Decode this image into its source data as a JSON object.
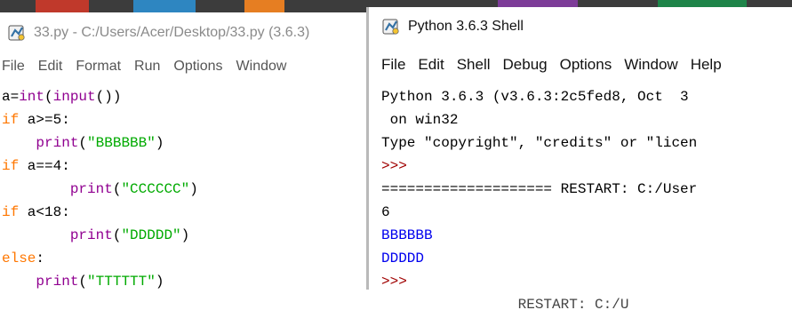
{
  "editor": {
    "title": "33.py - C:/Users/Acer/Desktop/33.py (3.6.3)",
    "menu": [
      "File",
      "Edit",
      "Format",
      "Run",
      "Options",
      "Window"
    ],
    "code": [
      [
        {
          "t": "a=",
          "c": "plain"
        },
        {
          "t": "int",
          "c": "bi"
        },
        {
          "t": "(",
          "c": "plain"
        },
        {
          "t": "input",
          "c": "bi"
        },
        {
          "t": "())",
          "c": "plain"
        }
      ],
      [
        {
          "t": "if",
          "c": "kw"
        },
        {
          "t": " a>=5:",
          "c": "plain"
        }
      ],
      [
        {
          "t": "    ",
          "c": "plain"
        },
        {
          "t": "print",
          "c": "bi"
        },
        {
          "t": "(",
          "c": "plain"
        },
        {
          "t": "\"BBBBBB\"",
          "c": "str"
        },
        {
          "t": ")",
          "c": "plain"
        }
      ],
      [
        {
          "t": "if",
          "c": "kw"
        },
        {
          "t": " a==4:",
          "c": "plain"
        }
      ],
      [
        {
          "t": "        ",
          "c": "plain"
        },
        {
          "t": "print",
          "c": "bi"
        },
        {
          "t": "(",
          "c": "plain"
        },
        {
          "t": "\"CCCCCC\"",
          "c": "str"
        },
        {
          "t": ")",
          "c": "plain"
        }
      ],
      [
        {
          "t": "if",
          "c": "kw"
        },
        {
          "t": " a<18:",
          "c": "plain"
        }
      ],
      [
        {
          "t": "        ",
          "c": "plain"
        },
        {
          "t": "print",
          "c": "bi"
        },
        {
          "t": "(",
          "c": "plain"
        },
        {
          "t": "\"DDDDD\"",
          "c": "str"
        },
        {
          "t": ")",
          "c": "plain"
        }
      ],
      [
        {
          "t": "else",
          "c": "kw"
        },
        {
          "t": ":",
          "c": "plain"
        }
      ],
      [
        {
          "t": "    ",
          "c": "plain"
        },
        {
          "t": "print",
          "c": "bi"
        },
        {
          "t": "(",
          "c": "plain"
        },
        {
          "t": "\"TTTTTT\"",
          "c": "str"
        },
        {
          "t": ")",
          "c": "plain"
        }
      ]
    ]
  },
  "shell": {
    "title": "Python 3.6.3 Shell",
    "menu": [
      "File",
      "Edit",
      "Shell",
      "Debug",
      "Options",
      "Window",
      "Help"
    ],
    "output": [
      {
        "t": "Python 3.6.3 (v3.6.3:2c5fed8, Oct  3",
        "c": "plain"
      },
      {
        "t": " on win32",
        "c": "plain"
      },
      {
        "t": "Type \"copyright\", \"credits\" or \"licen",
        "c": "plain"
      },
      {
        "t": ">>>",
        "c": "prompt"
      },
      {
        "t": "==================== RESTART: C:/User",
        "c": "plain"
      },
      {
        "t": "6",
        "c": "plain"
      },
      {
        "t": "BBBBBB",
        "c": "blue"
      },
      {
        "t": "DDDDD",
        "c": "blue"
      },
      {
        "t": ">>>",
        "c": "prompt"
      },
      {
        "t": "                RESTART: C:/U",
        "c": "partial"
      }
    ]
  }
}
